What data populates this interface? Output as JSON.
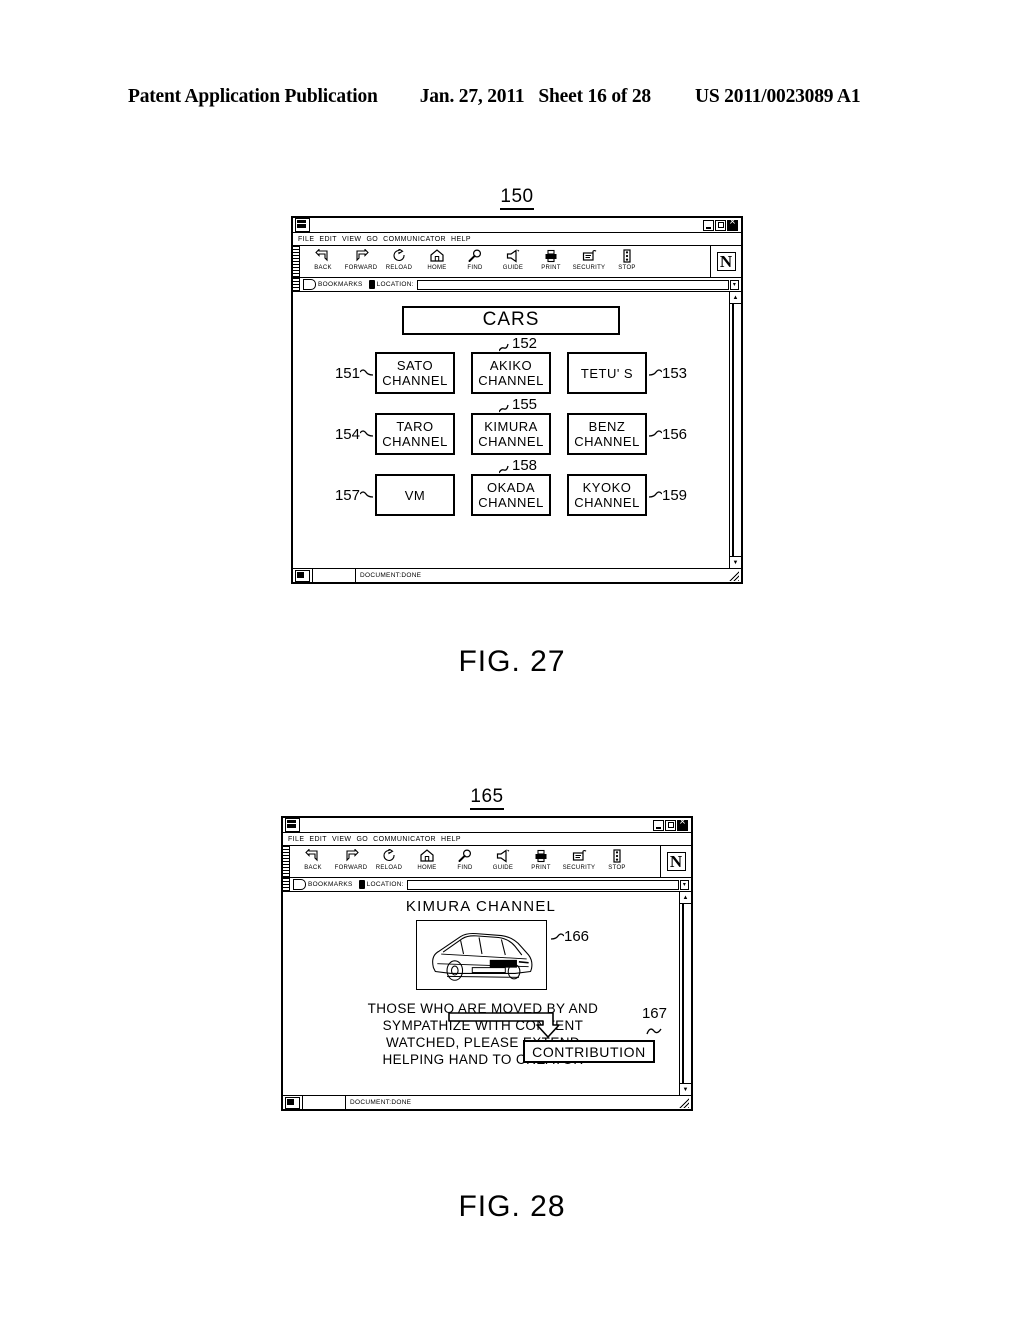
{
  "header": {
    "publication": "Patent Application Publication",
    "date": "Jan. 27, 2011",
    "sheet": "Sheet 16 of 28",
    "number": "US 2011/0023089 A1"
  },
  "browser_chrome": {
    "menu_items": [
      "FILE",
      "EDIT",
      "VIEW",
      "GO",
      "COMMUNICATOR",
      "HELP"
    ],
    "toolbar_buttons": [
      {
        "label": "BACK",
        "icon": "back-arrow-icon"
      },
      {
        "label": "FORWARD",
        "icon": "forward-arrow-icon"
      },
      {
        "label": "RELOAD",
        "icon": "reload-icon"
      },
      {
        "label": "HOME",
        "icon": "home-icon"
      },
      {
        "label": "FIND",
        "icon": "magnifier-icon"
      },
      {
        "label": "GUIDE",
        "icon": "guide-icon"
      },
      {
        "label": "PRINT",
        "icon": "printer-icon"
      },
      {
        "label": "SECURITY",
        "icon": "lock-icon"
      },
      {
        "label": "STOP",
        "icon": "stop-icon"
      }
    ],
    "logo": "N",
    "bookmarks_label": "BOOKMARKS",
    "location_label": "LOCATION:",
    "location_value": "",
    "status_text": "DOCUMENT:DONE"
  },
  "figure27": {
    "figure_ref": "150",
    "caption": "FIG. 27",
    "page_title": "CARS",
    "rows": [
      {
        "cells": [
          {
            "lines": [
              "SATO",
              "CHANNEL"
            ],
            "ref": "151",
            "ref_position": "left"
          },
          {
            "lines": [
              "AKIKO",
              "CHANNEL"
            ],
            "ref": "152",
            "ref_position": "top"
          },
          {
            "lines": [
              "TETU' S"
            ],
            "ref": "153",
            "ref_position": "right"
          }
        ]
      },
      {
        "cells": [
          {
            "lines": [
              "TARO",
              "CHANNEL"
            ],
            "ref": "154",
            "ref_position": "left"
          },
          {
            "lines": [
              "KIMURA",
              "CHANNEL"
            ],
            "ref": "155",
            "ref_position": "top"
          },
          {
            "lines": [
              "BENZ",
              "CHANNEL"
            ],
            "ref": "156",
            "ref_position": "right"
          }
        ]
      },
      {
        "cells": [
          {
            "lines": [
              "VM"
            ],
            "ref": "157",
            "ref_position": "left"
          },
          {
            "lines": [
              "OKADA",
              "CHANNEL"
            ],
            "ref": "158",
            "ref_position": "top"
          },
          {
            "lines": [
              "KYOKO",
              "CHANNEL"
            ],
            "ref": "159",
            "ref_position": "right"
          }
        ]
      }
    ]
  },
  "figure28": {
    "figure_ref": "165",
    "caption": "FIG. 28",
    "page_title": "KIMURA CHANNEL",
    "image_ref": "166",
    "image_alt": "car-illustration",
    "message_lines": [
      "THOSE WHO ARE MOVED BY AND",
      "SYMPATHIZE WITH CONTENT",
      "WATCHED, PLEASE EXTEND",
      "HELPING HAND TO CREATOR"
    ],
    "contribution_button": "CONTRIBUTION",
    "contribution_ref": "167"
  }
}
